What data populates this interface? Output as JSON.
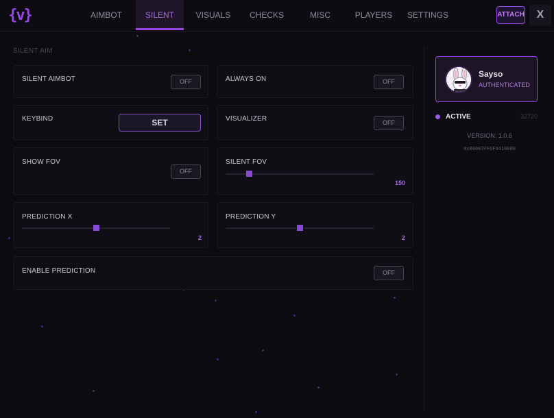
{
  "app": {
    "logo_text": "{v}",
    "accent_color": "#9b45e8"
  },
  "nav": {
    "tabs": [
      {
        "label": "AIMBOT",
        "active": false
      },
      {
        "label": "SILENT",
        "active": true
      },
      {
        "label": "VISUALS",
        "active": false
      },
      {
        "label": "CHECKS",
        "active": false
      },
      {
        "label": "MISC",
        "active": false
      },
      {
        "label": "PLAYERS",
        "active": false
      },
      {
        "label": "SETTINGS",
        "active": false
      }
    ],
    "attach_label": "ATTACH",
    "close_label": "X"
  },
  "section": {
    "title": "SILENT AIM"
  },
  "settings": {
    "silent_aimbot": {
      "label": "SILENT AIMBOT",
      "state": "OFF"
    },
    "always_on": {
      "label": "ALWAYS ON",
      "state": "OFF"
    },
    "keybind": {
      "label": "KEYBIND",
      "button": "SET"
    },
    "visualizer": {
      "label": "VISUALIZER",
      "state": "OFF"
    },
    "show_fov": {
      "label": "SHOW FOV",
      "state": "OFF"
    },
    "silent_fov": {
      "label": "SILENT FOV",
      "value": "150",
      "fraction": 0.16
    },
    "prediction_x": {
      "label": "PREDICTION X",
      "value": "2",
      "fraction": 0.5
    },
    "prediction_y": {
      "label": "PREDICTION Y",
      "value": "2",
      "fraction": 0.5
    },
    "enable_prediction": {
      "label": "ENABLE PREDICTION",
      "state": "OFF"
    }
  },
  "sidebar": {
    "username": "Sayso",
    "auth_status": "AUTHENTICATED",
    "status": "ACTIVE",
    "pid": "32720",
    "version": "VERSION: 1.0.6",
    "address": "0x00007FF6F4410000"
  }
}
